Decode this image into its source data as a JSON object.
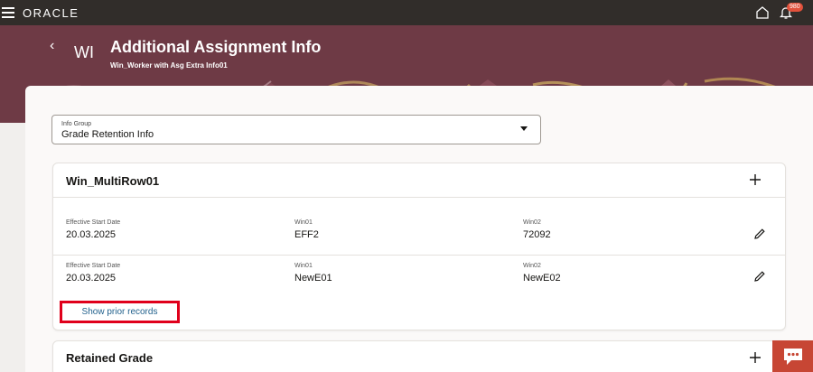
{
  "topbar": {
    "logo": "ORACLE",
    "notification_count": "980"
  },
  "header": {
    "back": "‹",
    "initials": "WI",
    "title": "Additional Assignment Info",
    "subtitle": "Win_Worker with Asg Extra Info01"
  },
  "info_group": {
    "label": "Info Group",
    "value": "Grade Retention Info"
  },
  "multirow_card": {
    "title": "Win_MultiRow01",
    "records": [
      {
        "start_label": "Effective Start Date",
        "start_value": "20.03.2025",
        "win01_label": "Win01",
        "win01_value": "EFF2",
        "win02_label": "Win02",
        "win02_value": "72092"
      },
      {
        "start_label": "Effective Start Date",
        "start_value": "20.03.2025",
        "win01_label": "Win01",
        "win01_value": "NewE01",
        "win02_label": "Win02",
        "win02_value": "NewE02"
      }
    ],
    "prior_link": "Show prior records"
  },
  "retained_card": {
    "title": "Retained Grade"
  },
  "colors": {
    "topbar": "#312d2a",
    "banner": "#6e3a45",
    "highlight": "#e0001b",
    "link": "#1f5f8b",
    "chat": "#c74634"
  }
}
